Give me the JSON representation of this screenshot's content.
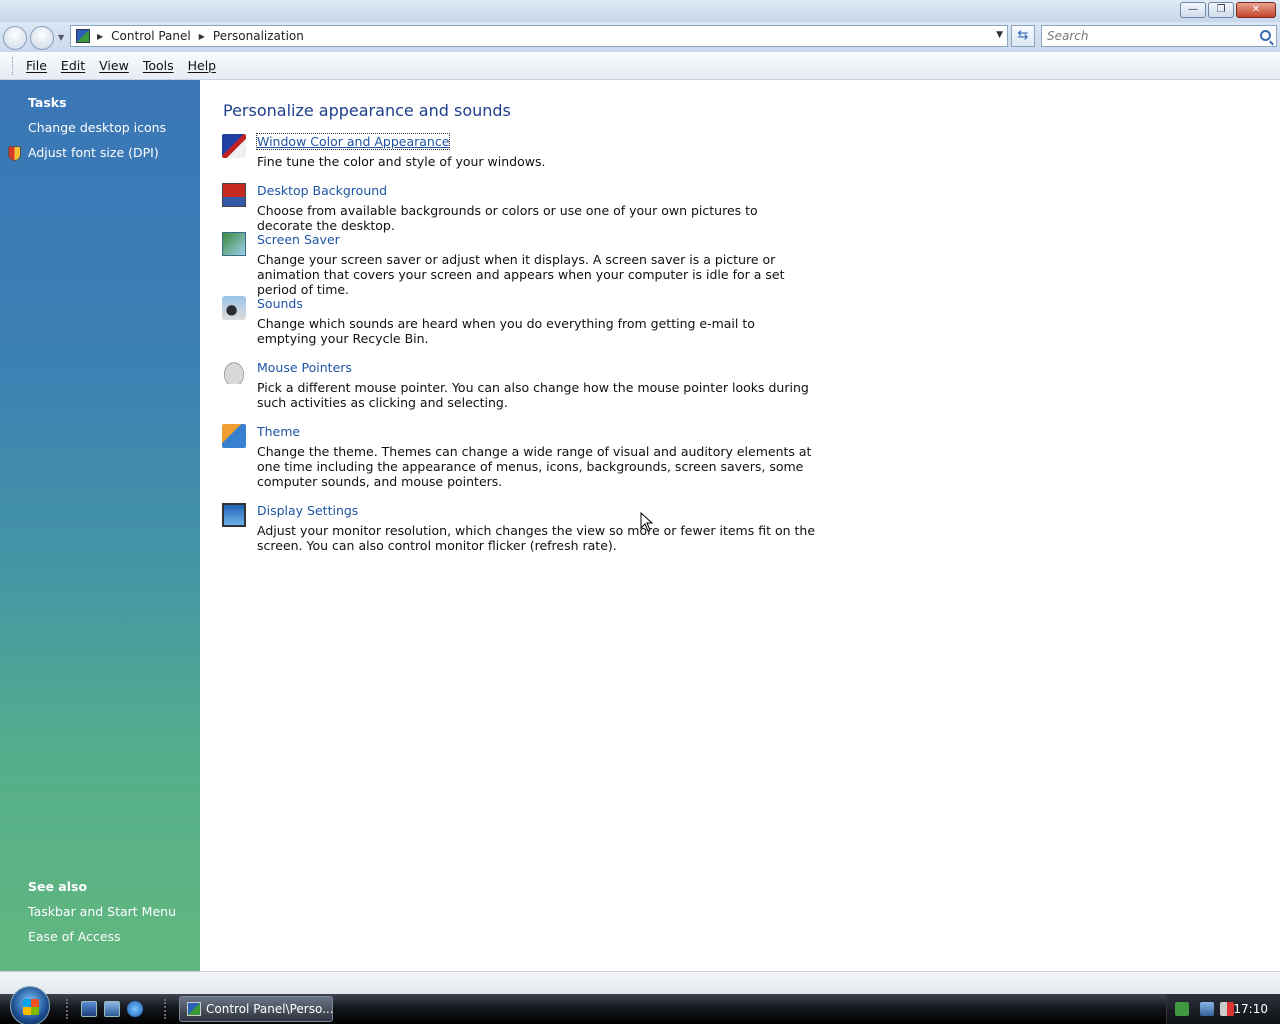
{
  "titlebar": {
    "buttons": {
      "minimize": "—",
      "maximize": "❐",
      "close": "✕"
    }
  },
  "address": {
    "breadcrumbs": [
      "Control Panel",
      "Personalization"
    ],
    "search_placeholder": "Search"
  },
  "menubar": [
    "File",
    "Edit",
    "View",
    "Tools",
    "Help"
  ],
  "sidebar": {
    "tasks_title": "Tasks",
    "tasks": [
      "Change desktop icons",
      "Adjust font size (DPI)"
    ],
    "see_also_title": "See also",
    "see_also": [
      "Taskbar and Start Menu",
      "Ease of Access"
    ]
  },
  "main": {
    "title": "Personalize appearance and sounds",
    "items": [
      {
        "icon": "window-color-icon",
        "label": "Window Color and Appearance",
        "description": "Fine tune the color and style of your windows."
      },
      {
        "icon": "desktop-background-icon",
        "label": "Desktop Background",
        "description": "Choose from available backgrounds or colors or use one of your own pictures to decorate the desktop."
      },
      {
        "icon": "screen-saver-icon",
        "label": "Screen Saver",
        "description": "Change your screen saver or adjust when it displays. A screen saver is a picture or animation that covers your screen and appears when your computer is idle for a set period of time."
      },
      {
        "icon": "sounds-icon",
        "label": "Sounds",
        "description": "Change which sounds are heard when you do everything from getting e-mail to emptying your Recycle Bin."
      },
      {
        "icon": "mouse-pointers-icon",
        "label": "Mouse Pointers",
        "description": "Pick a different mouse pointer. You can also change how the mouse pointer looks during such activities as clicking and selecting."
      },
      {
        "icon": "theme-icon",
        "label": "Theme",
        "description": "Change the theme. Themes can change a wide range of visual and auditory elements at one time including the appearance of menus, icons, backgrounds, screen savers, some computer sounds, and mouse pointers."
      },
      {
        "icon": "display-settings-icon",
        "label": "Display Settings",
        "description": "Adjust your monitor resolution, which changes the view so more or fewer items fit on the screen. You can also control monitor flicker (refresh rate)."
      }
    ]
  },
  "taskbar": {
    "task_button": "Control Panel\\Perso...",
    "clock": "17:10"
  }
}
